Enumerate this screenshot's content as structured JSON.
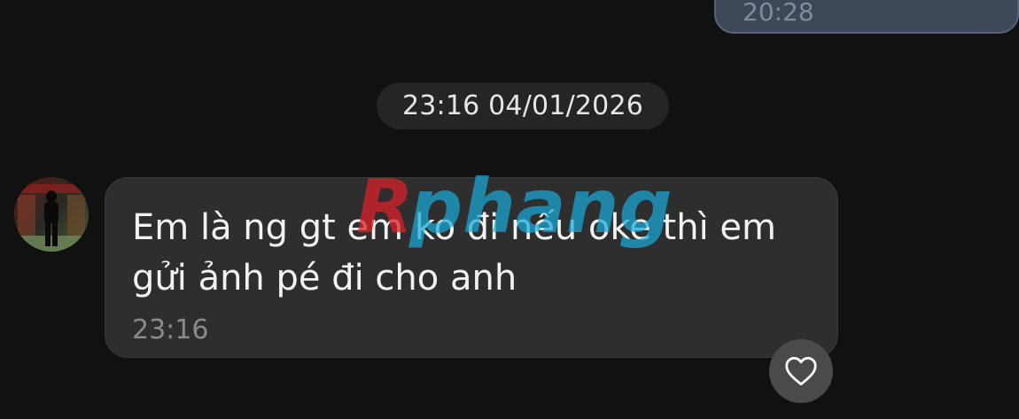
{
  "previous_message": {
    "time": "20:28"
  },
  "date_separator": {
    "text": "23:16 04/01/2026"
  },
  "incoming_message": {
    "text": "Em là ng gt em ko đi nếu oke thì em\ngửi ảnh pé đi cho anh",
    "time": "23:16"
  },
  "reaction_button": {
    "icon": "heart-outline-icon"
  },
  "watermark": {
    "text": "Rphang"
  },
  "colors": {
    "background": "#111111",
    "outgoing_bubble": "#3c4757",
    "incoming_bubble": "#2e2e2e",
    "date_pill": "#252525",
    "watermark_red": "#d8232a",
    "watermark_blue": "#1aa9d6"
  }
}
